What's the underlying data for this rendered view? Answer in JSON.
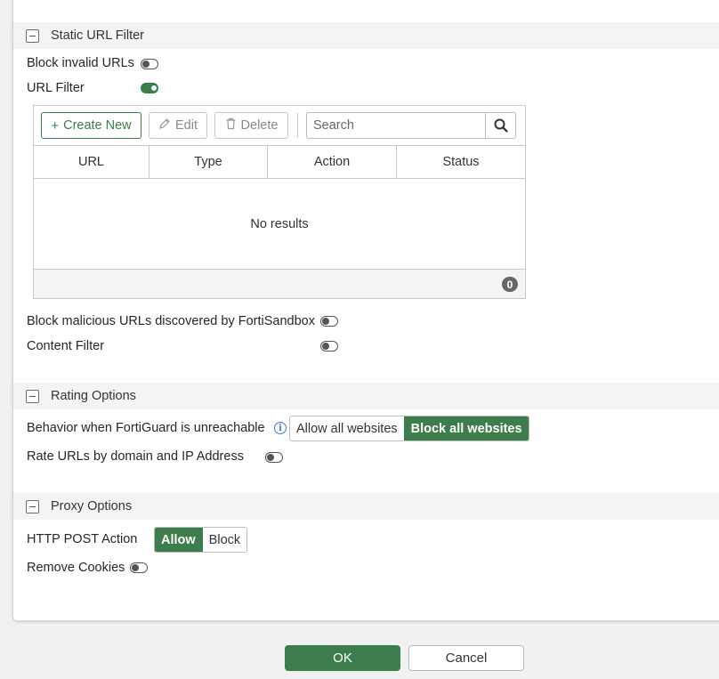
{
  "static_url_filter": {
    "title": "Static URL Filter",
    "block_invalid_urls": {
      "label": "Block invalid URLs",
      "enabled": false
    },
    "url_filter": {
      "label": "URL Filter",
      "enabled": true
    },
    "toolbar": {
      "create_new": "Create New",
      "edit": "Edit",
      "delete": "Delete",
      "search_placeholder": "Search"
    },
    "table": {
      "columns": [
        "URL",
        "Type",
        "Action",
        "Status"
      ],
      "empty_text": "No results",
      "count": "0"
    },
    "block_malicious": {
      "label": "Block malicious URLs discovered by FortiSandbox",
      "enabled": false
    },
    "content_filter": {
      "label": "Content Filter",
      "enabled": false
    }
  },
  "rating_options": {
    "title": "Rating Options",
    "behavior": {
      "label": "Behavior when FortiGuard is unreachable",
      "options": [
        "Allow all websites",
        "Block all websites"
      ],
      "selected": "Block all websites"
    },
    "rate_urls": {
      "label": "Rate URLs by domain and IP Address",
      "enabled": false
    }
  },
  "proxy_options": {
    "title": "Proxy Options",
    "http_post": {
      "label": "HTTP POST Action",
      "options": [
        "Allow",
        "Block"
      ],
      "selected": "Allow"
    },
    "remove_cookies": {
      "label": "Remove Cookies",
      "enabled": false
    }
  },
  "footer": {
    "ok": "OK",
    "cancel": "Cancel"
  },
  "colors": {
    "accent_green": "#3d7d4c",
    "info_blue": "#3a7ec2"
  }
}
